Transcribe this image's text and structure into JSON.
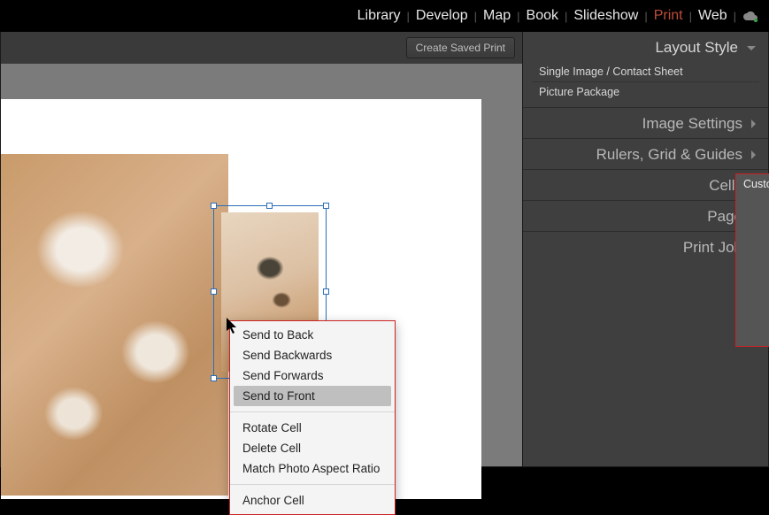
{
  "modules": {
    "library": "Library",
    "develop": "Develop",
    "map": "Map",
    "book": "Book",
    "slideshow": "Slideshow",
    "print": "Print",
    "web": "Web",
    "active": "print"
  },
  "toolbar": {
    "create_saved_print": "Create Saved Print"
  },
  "context_menu": {
    "items": [
      "Send to Back",
      "Send Backwards",
      "Send Forwards",
      "Send to Front",
      "Rotate Cell",
      "Delete Cell",
      "Match Photo Aspect Ratio",
      "Anchor Cell"
    ],
    "highlighted_index": 3
  },
  "right_panel": {
    "layout_style": {
      "title": "Layout Style",
      "options": [
        "Single Image / Contact Sheet",
        "Picture Package",
        "Custom Package"
      ],
      "selected_index": 2
    },
    "sections": [
      "Image Settings",
      "Rulers, Grid & Guides",
      "Cells",
      "Page",
      "Print Job"
    ]
  }
}
